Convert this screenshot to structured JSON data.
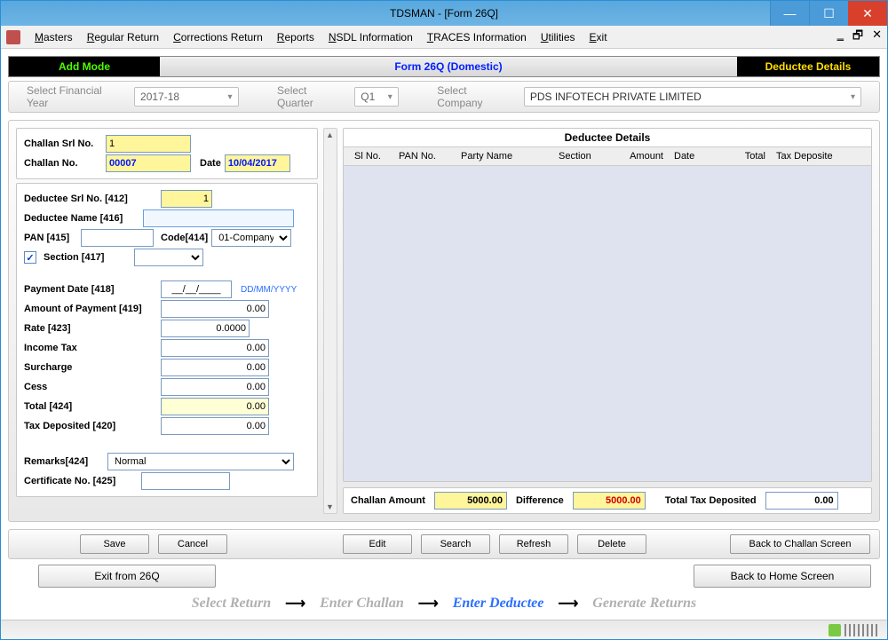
{
  "window": {
    "title": "TDSMAN - [Form 26Q]"
  },
  "menu": {
    "items": [
      "Masters",
      "Regular Return",
      "Corrections Return",
      "Reports",
      "NSDL Information",
      "TRACES Information",
      "Utilities",
      "Exit"
    ]
  },
  "modebar": {
    "left": "Add Mode",
    "mid": "Form 26Q (Domestic)",
    "right": "Deductee Details"
  },
  "filters": {
    "fy_label": "Select Financial Year",
    "fy_value": "2017-18",
    "q_label": "Select Quarter",
    "q_value": "Q1",
    "co_label": "Select Company",
    "co_value": "PDS INFOTECH PRIVATE LIMITED"
  },
  "challan": {
    "srl_label": "Challan Srl No.",
    "srl_value": "1",
    "no_label": "Challan No.",
    "no_value": "00007",
    "date_label": "Date",
    "date_value": "10/04/2017"
  },
  "deductee": {
    "srl_label": "Deductee Srl No. [412]",
    "srl_value": "1",
    "name_label": "Deductee Name [416]",
    "name_value": "",
    "pan_label": "PAN [415]",
    "pan_value": "",
    "code_label": "Code[414]",
    "code_value": "01-Company",
    "section_label": "Section [417]",
    "section_value": "",
    "section_checked": "✓"
  },
  "payment": {
    "date_label": "Payment Date [418]",
    "date_value": "__/__/____",
    "date_hint": "DD/MM/YYYY",
    "amt_label": "Amount of Payment [419]",
    "amt_value": "0.00",
    "rate_label": "Rate [423]",
    "rate_value": "0.0000",
    "it_label": "Income Tax",
    "it_value": "0.00",
    "sur_label": "Surcharge",
    "sur_value": "0.00",
    "cess_label": "Cess",
    "cess_value": "0.00",
    "total_label": "Total [424]",
    "total_value": "0.00",
    "dep_label": "Tax Deposited [420]",
    "dep_value": "0.00",
    "remarks_label": "Remarks[424]",
    "remarks_value": "Normal",
    "cert_label": "Certificate No. [425]",
    "cert_value": ""
  },
  "grid": {
    "title": "Deductee  Details",
    "cols": [
      "Sl No.",
      "PAN No.",
      "Party Name",
      "Section",
      "Amount",
      "Date",
      "Total",
      "Tax Deposite"
    ]
  },
  "summary": {
    "ca_label": "Challan Amount",
    "ca_value": "5000.00",
    "diff_label": "Difference",
    "diff_value": "5000.00",
    "dep_label": "Total Tax Deposited",
    "dep_value": "0.00"
  },
  "buttons": {
    "save": "Save",
    "cancel": "Cancel",
    "edit": "Edit",
    "search": "Search",
    "refresh": "Refresh",
    "delete": "Delete",
    "back_challan": "Back to Challan Screen",
    "exit": "Exit from 26Q",
    "back_home": "Back to Home Screen"
  },
  "flow": {
    "s1": "Select Return",
    "s2": "Enter Challan",
    "s3": "Enter Deductee",
    "s4": "Generate Returns"
  }
}
